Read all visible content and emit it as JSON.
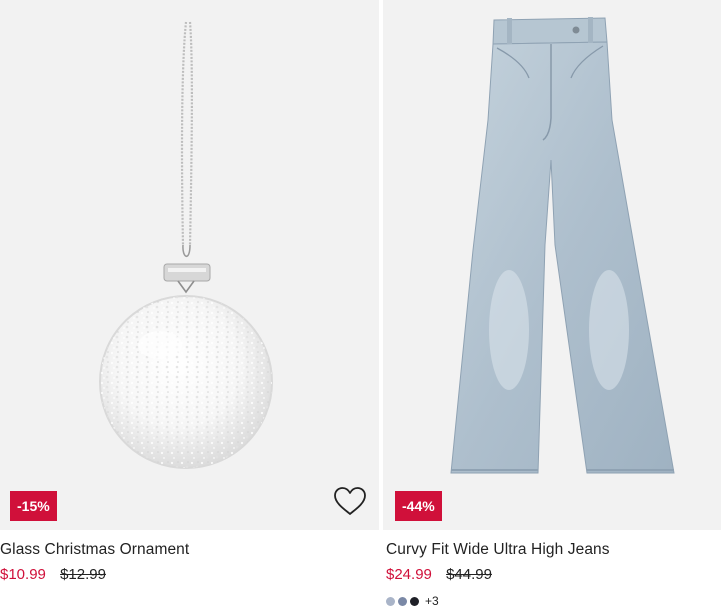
{
  "products": [
    {
      "name": "Glass Christmas Ornament",
      "sale_price": "$10.99",
      "original_price": "$12.99",
      "discount_badge": "-15%",
      "favorite_icon": "heart-outline-icon"
    },
    {
      "name": "Curvy Fit Wide Ultra High Jeans",
      "sale_price": "$24.99",
      "original_price": "$44.99",
      "discount_badge": "-44%",
      "swatch_colors": [
        "#a9b4c8",
        "#7a88a6",
        "#1f2027"
      ],
      "more_colors": "+3"
    }
  ],
  "colors": {
    "sale_red": "#d0103a",
    "text": "#222222",
    "image_bg": "#f2f2f2"
  }
}
